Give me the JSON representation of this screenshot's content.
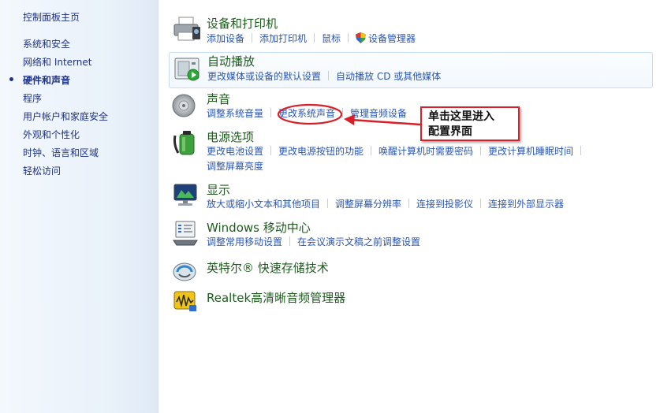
{
  "sidebar": {
    "items": [
      {
        "label": "控制面板主页"
      },
      {
        "label": "系统和安全"
      },
      {
        "label": "网络和 Internet"
      },
      {
        "label": "硬件和声音"
      },
      {
        "label": "程序"
      },
      {
        "label": "用户帐户和家庭安全"
      },
      {
        "label": "外观和个性化"
      },
      {
        "label": "时钟、语言和区域"
      },
      {
        "label": "轻松访问"
      }
    ]
  },
  "categories": {
    "devices": {
      "title": "设备和打印机",
      "icon": "printer-icon",
      "links": [
        "添加设备",
        "添加打印机",
        "鼠标",
        "设备管理器"
      ]
    },
    "autoplay": {
      "title": "自动播放",
      "icon": "autoplay-icon",
      "links": [
        "更改媒体或设备的默认设置",
        "自动播放 CD 或其他媒体"
      ]
    },
    "sound": {
      "title": "声音",
      "icon": "speaker-icon",
      "links": [
        "调整系统音量",
        "更改系统声音",
        "管理音频设备"
      ]
    },
    "power": {
      "title": "电源选项",
      "icon": "battery-icon",
      "links": [
        "更改电池设置",
        "更改电源按钮的功能",
        "唤醒计算机时需要密码",
        "更改计算机睡眠时间",
        "调整屏幕亮度"
      ]
    },
    "display": {
      "title": "显示",
      "icon": "monitor-icon",
      "links": [
        "放大或缩小文本和其他项目",
        "调整屏幕分辨率",
        "连接到投影仪",
        "连接到外部显示器"
      ]
    },
    "mobility": {
      "title": "Windows 移动中心",
      "icon": "mobility-center-icon",
      "links": [
        "调整常用移动设置",
        "在会议演示文稿之前调整设置"
      ]
    },
    "intel": {
      "title": "英特尔® 快速存储技术",
      "icon": "storage-icon"
    },
    "realtek": {
      "title": "Realtek高清晰音频管理器",
      "icon": "audio-manager-icon"
    }
  },
  "annotation": {
    "line1": "单击这里进入",
    "line2": "配置界面",
    "color": "#d8202a"
  },
  "colors": {
    "link": "#2a56b2",
    "title": "#1e5c1e",
    "sidebar": "#1e3287"
  }
}
